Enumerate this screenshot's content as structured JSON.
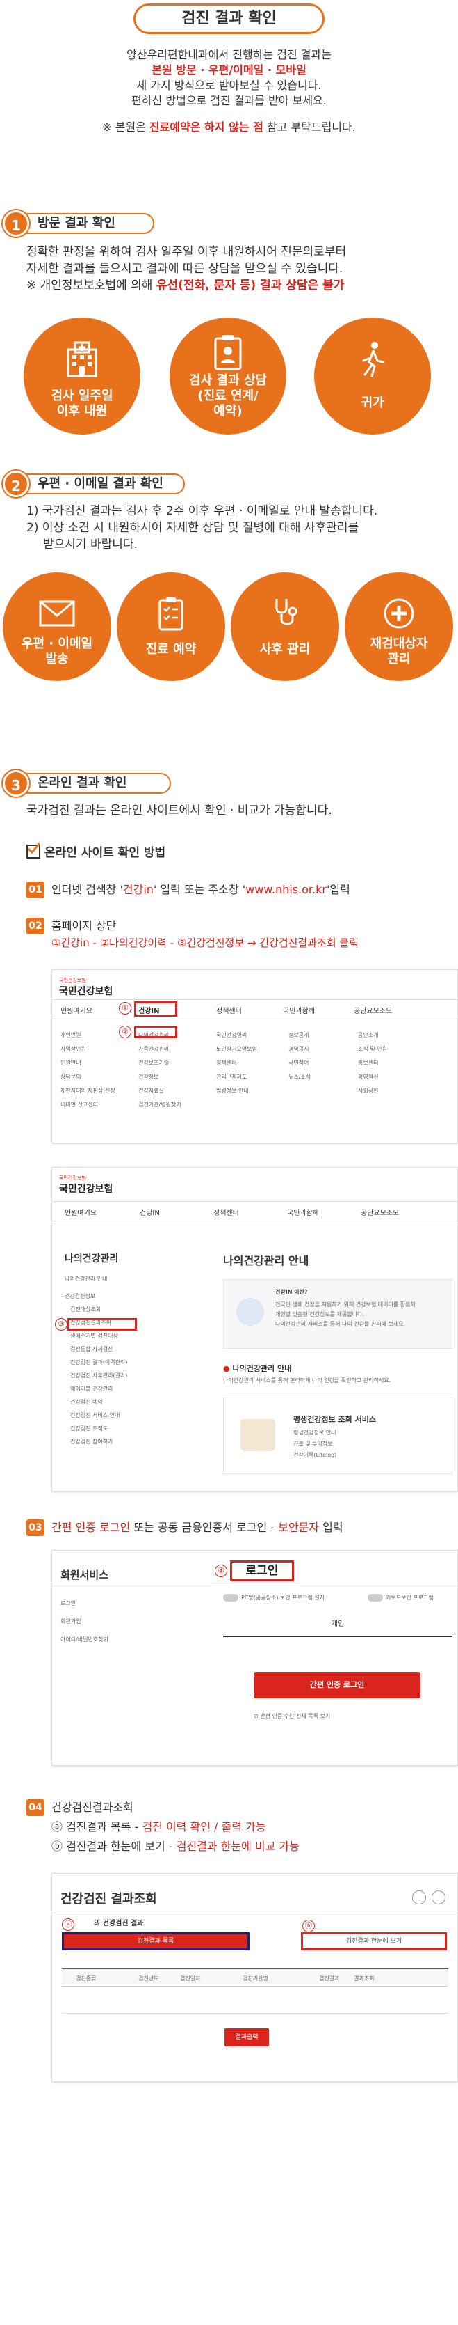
{
  "title": "검진 결과 확인",
  "intro": {
    "line1": "양산우리편한내과에서 진행하는 검진 결과는",
    "line2": "본원 방문 · 우편/이메일 · 모바일",
    "line3": "세 가지 방식으로 받아보실 수 있습니다.",
    "line4": "편하신 방법으로 검진 결과를 받아 보세요.",
    "notice_pre": "※ 본원은 ",
    "notice_red": "진료예약은 하지 않는 점",
    "notice_post": " 참고 부탁드립니다."
  },
  "section1": {
    "num": "1",
    "title": "방문 결과 확인",
    "p1": "정확한 판정을 위하여 검사 일주일 이후 내원하시어 전문의로부터",
    "p2": "자세한 결과를 들으시고 결과에 따른 상담을 받으실 수 있습니다.",
    "p3_pre": "※ 개인정보보호법에 의해 ",
    "p3_red": "유선(전화, 문자 등) 결과 상담은 불가",
    "circles": [
      {
        "line1": "검사 일주일",
        "line2": "이후 내원",
        "icon": "hospital-icon"
      },
      {
        "line1": "검사 결과 상담",
        "line2": "(진료 연계/",
        "line3": "예약)",
        "icon": "clipboard-doctor-icon"
      },
      {
        "line1": "귀가",
        "icon": "walking-person-icon"
      }
    ]
  },
  "section2": {
    "num": "2",
    "title": "우편 · 이메일 결과 확인",
    "p1": "1) 국가검진 결과는 검사 후 2주 이후 우편 · 이메일로 안내 발송합니다.",
    "p2": "2) 이상 소견 시 내원하시어 자세한 상담 및 질병에 대해 사후관리를",
    "p3": "받으시기 바랍니다.",
    "circles": [
      {
        "line1": "우편 · 이메일",
        "line2": "발송",
        "icon": "envelope-icon"
      },
      {
        "line1": "진료 예약",
        "icon": "clipboard-check-icon"
      },
      {
        "line1": "사후 관리",
        "icon": "stethoscope-icon"
      },
      {
        "line1": "재검대상자",
        "line2": "관리",
        "icon": "medical-cross-icon"
      }
    ]
  },
  "section3": {
    "num": "3",
    "title": "온라인 결과 확인",
    "p1": "국가검진 결과는 온라인 사이트에서 확인 · 비교가 가능합니다.",
    "method_title": "온라인 사이트 확인 방법",
    "step1": {
      "num": "01",
      "pre": "인터넷 검색창 '",
      "red1": "건강in",
      "mid": "' 입력 또는 주소창 '",
      "red2": "www.nhis.or.kr",
      "post": "'입력"
    },
    "step2": {
      "num": "02",
      "line1": "홈페이지 상단",
      "line2": "①건강in - ②나의건강이력 - ③건강검진정보 → 건강검진결과조회 클릭"
    },
    "step3": {
      "num": "03",
      "red1": "간편 인증 로그인",
      "mid1": " 또는 공동 금융인증서 로그인 - ",
      "red2": "보안문자",
      "post": " 입력"
    },
    "step4": {
      "num": "04",
      "title": "건강검진결과조회",
      "a_pre": "ⓐ 검진결과 목록 - ",
      "a_red": "검진 이력 확인 / 출력 가능",
      "b_pre": "ⓑ 검진결과 한눈에 보기 - ",
      "b_red": "검진결과 한눈에 비교 가능"
    }
  },
  "shot1": {
    "logo_small": "국민건강보험",
    "logo": "국민건강보험",
    "menu": [
      "민원여기요",
      "건강IN",
      "정책센터",
      "국민과함께",
      "공단요모조모"
    ],
    "col1": [
      "개인민원",
      "사업장민원",
      "민원안내",
      "상담문의",
      "재판지대외 재판상 신청",
      "비대면 신고센터"
    ],
    "col2": [
      "나의건강관리",
      "가족건강관리",
      "건강보조기술",
      "건강정보",
      "건강자료실",
      "검진기관/병원찾기"
    ],
    "col3": [
      "국민건강영리",
      "노인장기요양보험",
      "정책센터",
      "관리구제제도",
      "법령정보 안내"
    ],
    "col4": [
      "정보공개",
      "경영공시",
      "국민참여",
      "뉴스/소식"
    ],
    "col5": [
      "공단소개",
      "조직 및 인원",
      "홍보센터",
      "경영혁신",
      "사회공헌"
    ],
    "badge1": "①",
    "badge2": "②"
  },
  "shot2": {
    "menu": [
      "민원여기요",
      "건강IN",
      "정책센터",
      "국민과함께",
      "공단요모조모"
    ],
    "side_title": "나의건강관리",
    "side_items": [
      "나의건강관리 안내",
      "건강검진정보",
      "검진대상조회",
      "건강검진결과조회",
      "생애주기별 검진대상",
      "검진통합 자체검진",
      "건강검진 결과(이력관리)",
      "건강검진 사후관리(결과)",
      "웨어러블 건강관리",
      "건강검진 예약",
      "건강검진 서비스 안내",
      "건강검진 조직도",
      "건강검진 참여하기"
    ],
    "main_title": "나의건강관리 안내",
    "info_title": "건강IN 이란?",
    "info_lines": [
      "전국민 생애 건강을 지원하기 위해 건강보험 데이터를 활용해",
      "개인별 맞춤형 건강정보를 제공합니다.",
      "나의건강관리 서비스를 통해 나의 건강을 관리해 보세요."
    ],
    "sub_title": "나의건강관리 안내",
    "sub_desc": "나의건강관리 서비스를 통해 편리하게 나의 건강을 확인하고 관리하세요.",
    "card_title": "평생건강정보 조회 서비스",
    "card_items": [
      "평생건강정보 안내",
      "진료 및 투약정보",
      "건강기록(Lifelog)"
    ],
    "badge3": "③"
  },
  "shot3": {
    "title": "회원서비스",
    "side": [
      "로그인",
      "회원가입",
      "아이디/비밀번호찾기"
    ],
    "login_label": "로그인",
    "badge4": "④",
    "opt1": "PC방(공공장소) 보안 프로그램 설치",
    "opt2": "키보드보안 프로그램",
    "tab": "개인",
    "btn": "간편 인증 로그인",
    "note": "간편 인증 수단 전체 목록 보기"
  },
  "shot4": {
    "title": "건강검진 결과조회",
    "sub": "의 건강검진 결과",
    "btn_a": "검진결과 목록",
    "btn_b": "검진결과 한눈에 보기",
    "badge_a": "ⓐ",
    "badge_b": "ⓑ",
    "cols": [
      "검진종류",
      "검진년도",
      "검진일자",
      "검진기관명",
      "검진결과",
      "결과조회"
    ],
    "print": "결과출력"
  }
}
